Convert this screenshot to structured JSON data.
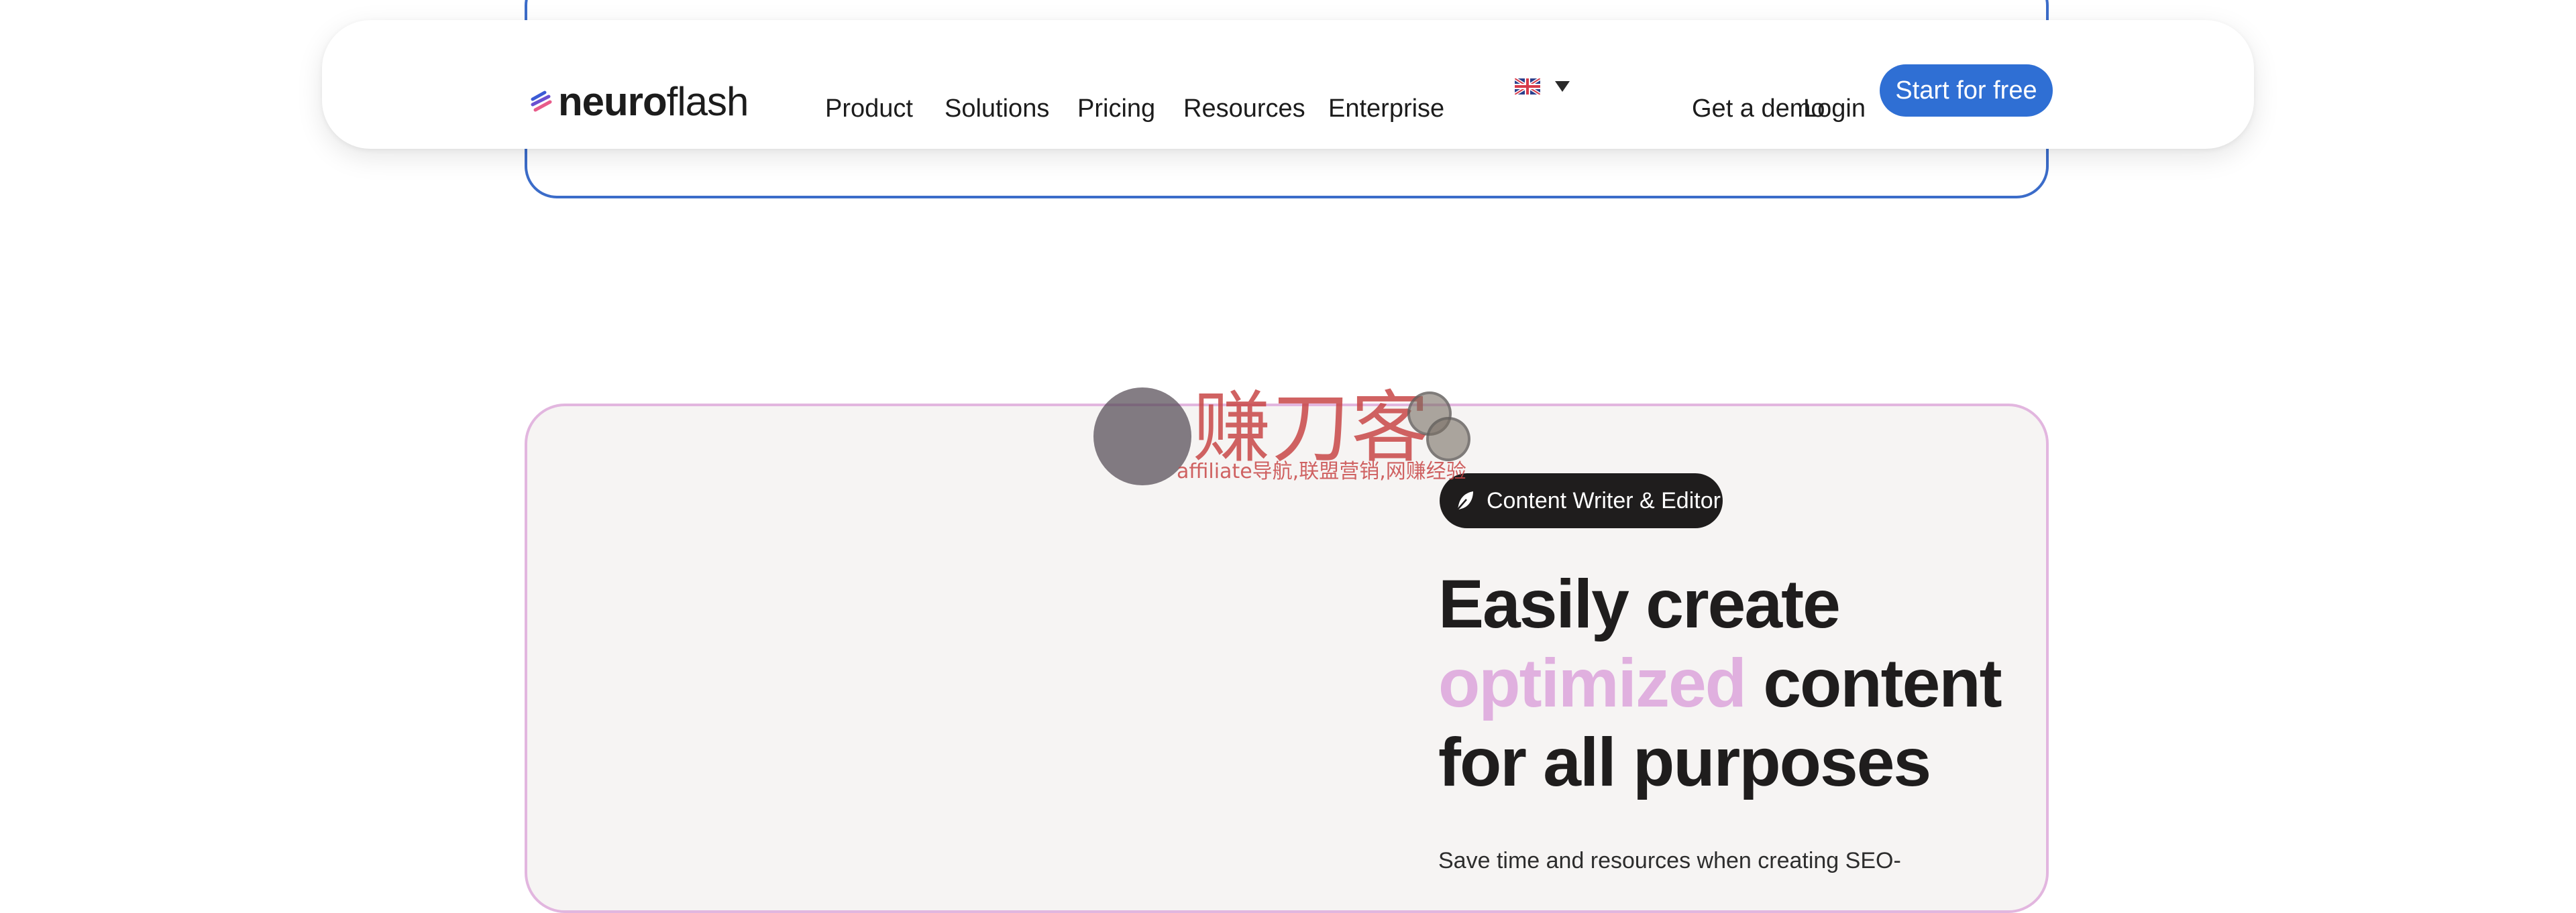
{
  "logo": {
    "bold": "neuro",
    "light": "flash",
    "mark_colors": [
      "#3b5bd6",
      "#e85b8a"
    ]
  },
  "nav": {
    "items": [
      "Product",
      "Solutions",
      "Pricing",
      "Resources",
      "Enterprise"
    ],
    "language_icon": "uk-flag-icon"
  },
  "header_actions": {
    "demo": "Get a demo",
    "login": "Login",
    "start": "Start for free"
  },
  "feature": {
    "badge_icon": "feather-pen-icon",
    "badge_label": "Content Writer & Editor",
    "headline_line1": "Easily create",
    "headline_accent": "optimized",
    "headline_rest": " content",
    "headline_line3": "for all purposes",
    "body": "Save time and resources when creating SEO-"
  },
  "watermark": {
    "title": "赚刀客",
    "subtitle": "affiliate导航,联盟营销,网赚经验"
  },
  "colors": {
    "accent_blue": "#2f6fd4",
    "accent_pink": "#e0b0df",
    "card_bg": "#f6f4f3"
  }
}
